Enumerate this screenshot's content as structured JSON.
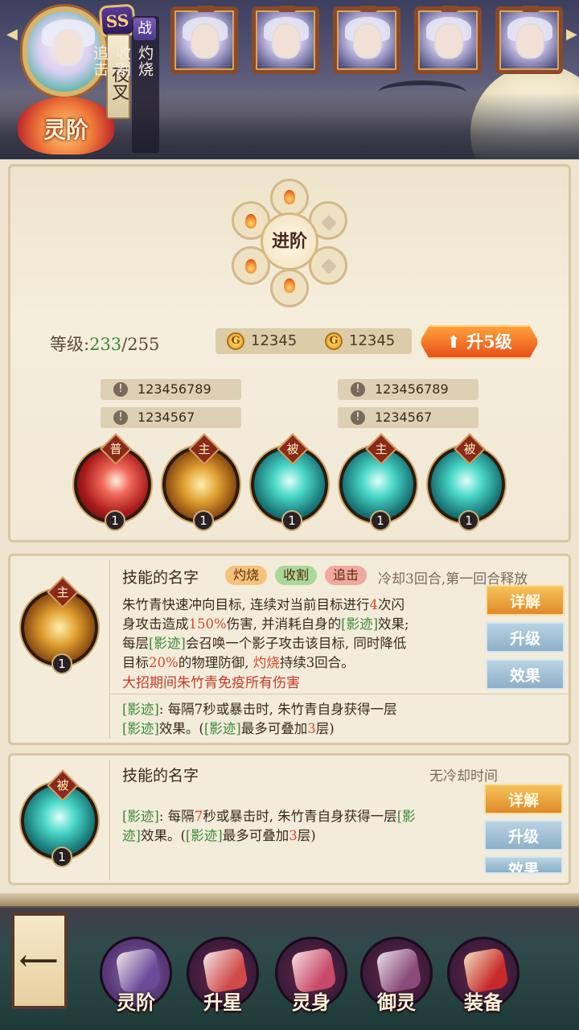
{
  "hero": {
    "rank_badge": "SS",
    "name": "夜叉",
    "role": "战",
    "traits": [
      "灼烧",
      "收割",
      "追击"
    ],
    "stage_label": "灵阶",
    "roster_count": 5
  },
  "upgrade": {
    "title": "进阶",
    "level_label": "等级:",
    "level_current": "233",
    "level_max": "/255",
    "costs": [
      "12345",
      "12345"
    ],
    "coin_icon": "G",
    "upgrade_button": "升5级",
    "stats_left": [
      "123456789",
      "1234567"
    ],
    "stats_right": [
      "123456789",
      "1234567"
    ],
    "skills": [
      {
        "type": "普",
        "level": "1",
        "style": "sk-red"
      },
      {
        "type": "主",
        "level": "1",
        "style": "sk-gold"
      },
      {
        "type": "被",
        "level": "1",
        "style": "sk-teal"
      },
      {
        "type": "主",
        "level": "1",
        "style": "sk-teal"
      },
      {
        "type": "被",
        "level": "1",
        "style": "sk-teal"
      }
    ]
  },
  "skill_card_1": {
    "type": "主",
    "level": "1",
    "name": "技能的名字",
    "tags": [
      "灼烧",
      "收割",
      "追击"
    ],
    "cooldown": "冷却3回合,第一回合释放",
    "desc_line1_a": "朱竹青快速冲向目标, 连续对当前目标进行",
    "desc_line1_b": "4",
    "desc_line1_c": "次闪",
    "desc_line2_a": "身攻击造成",
    "desc_line2_b": "150%",
    "desc_line2_c": "伤害, 并消耗自身的",
    "desc_line2_d": "[影迹]",
    "desc_line2_e": "效果;",
    "desc_line3_a": "每层",
    "desc_line3_b": "[影迹]",
    "desc_line3_c": "会召唤一个影子攻击该目标, 同时降低",
    "desc_line4_a": "目标",
    "desc_line4_b": "20%",
    "desc_line4_c": "的物理防御, ",
    "desc_line4_d": "灼烧",
    "desc_line4_e": "持续3回合。",
    "special": "大招期间朱竹青免疫所有伤害",
    "note_line1_a": "[影迹]",
    "note_line1_b": ": 每隔7秒或暴击时, 朱竹青自身获得一层",
    "note_line2_a": "[影迹]",
    "note_line2_b": "效果。(",
    "note_line2_c": "[影迹]",
    "note_line2_d": "最多可叠加",
    "note_line2_e": "3",
    "note_line2_f": "层)",
    "buttons": [
      "详解",
      "升级",
      "效果"
    ]
  },
  "skill_card_2": {
    "type": "被",
    "level": "1",
    "name": "技能的名字",
    "cooldown": "无冷却时间",
    "line1_a": "[影迹]",
    "line1_b": ": 每隔",
    "line1_c": "7",
    "line1_d": "秒或暴击时, 朱竹青自身获得一层",
    "line1_e": "[影",
    "line2_a": "迹]",
    "line2_b": "效果。(",
    "line2_c": "[影迹]",
    "line2_d": "最多可叠加",
    "line2_e": "3",
    "line2_f": "层)",
    "buttons": [
      "详解",
      "升级",
      "效果"
    ]
  },
  "nav": {
    "items": [
      "灵阶",
      "升星",
      "灵身",
      "御灵",
      "装备"
    ],
    "active": "灵阶"
  },
  "colors": {
    "accent_orange": "#e8501a",
    "green": "#3a8a3a",
    "red": "#d84a2a",
    "panel": "#efe4cf"
  }
}
